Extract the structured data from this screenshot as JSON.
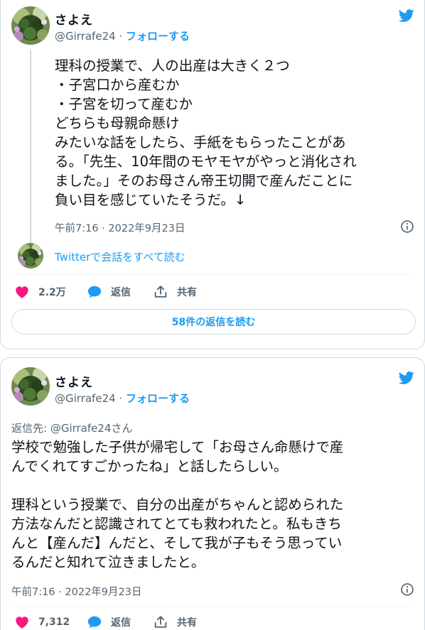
{
  "tweets": [
    {
      "display_name": "さよえ",
      "handle": "@Girrafe24",
      "separator": " · ",
      "follow_label": "フォローする",
      "text": "理科の授業で、人の出産は大きく２つ\n・子宮口から産むか\n・子宮を切って産むか\nどちらも母親命懸け\nみたいな話をしたら、手紙をもらったことがあ\nる。「先生、10年間のモヤモヤがやっと消化され\nました。」そのお母さん帝王切開で産んだことに\n負い目を感じていたそうだ。↓",
      "timestamp": "午前7:16 · 2022年9月23日",
      "thread_link": "Twitterで会話をすべて読む",
      "likes": "2.2万",
      "reply_label": "返信",
      "share_label": "共有",
      "read_replies": "58件の返信を読む"
    },
    {
      "display_name": "さよえ",
      "handle": "@Girrafe24",
      "separator": " · ",
      "follow_label": "フォローする",
      "replying_to": "返信先: @Girrafe24さん",
      "text": "学校で勉強した子供が帰宅して「お母さん命懸けで産\nんでくれてすごかったね」と話したらしい。\n\n理科という授業で、自分の出産がちゃんと認められた\n方法なんだと認識されてとても救われたと。私もきち\nんと【産んだ】んだと、そして我が子もそう思ってい\nるんだと知れて泣きましたと。",
      "timestamp": "午前7:16 · 2022年9月23日",
      "likes": "7,312",
      "reply_label": "返信",
      "share_label": "共有"
    }
  ],
  "colors": {
    "accent": "#1d9bf0",
    "like": "#f91880",
    "text": "#0f1419",
    "muted": "#536471",
    "border": "#cfd9de"
  },
  "icons": [
    "twitter-bird-icon",
    "info-icon",
    "heart-icon",
    "reply-bubble-icon",
    "share-icon"
  ]
}
